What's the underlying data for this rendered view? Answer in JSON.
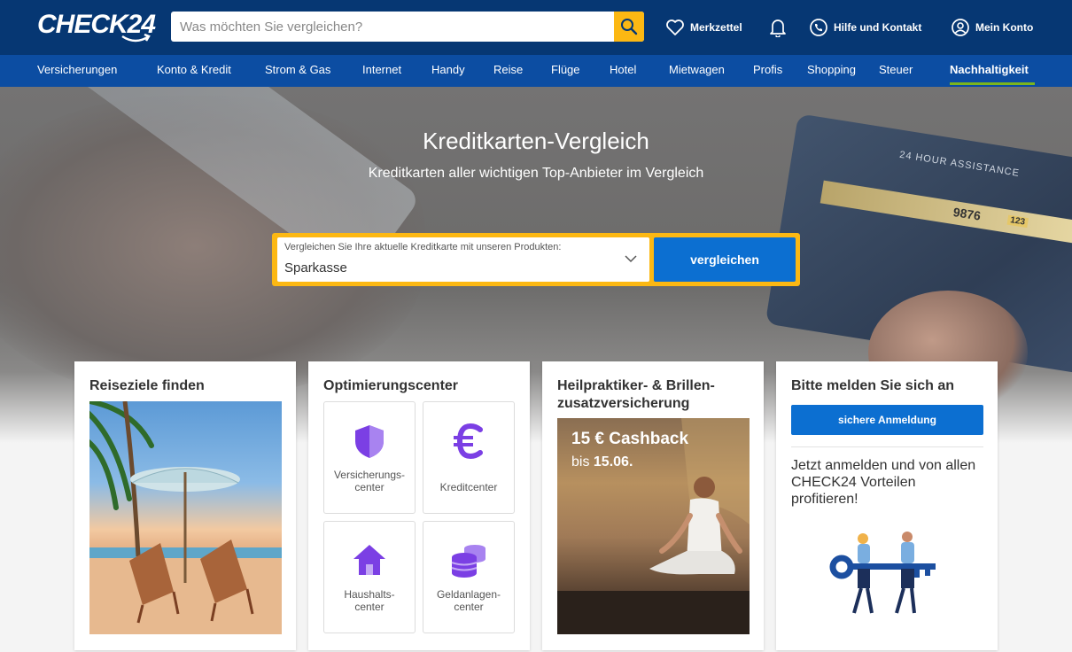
{
  "header": {
    "logo": "CHECK24",
    "search_placeholder": "Was möchten Sie vergleichen?",
    "search_icon": "search-icon",
    "items": [
      {
        "label": "Merkzettel",
        "icon": "heart-icon"
      },
      {
        "label": "",
        "icon": "bell-icon"
      },
      {
        "label": "Hilfe und Kontakt",
        "icon": "phone-chat-icon"
      },
      {
        "label": "Mein Konto",
        "icon": "user-icon"
      }
    ]
  },
  "nav": {
    "items": [
      "Versicherungen",
      "Konto & Kredit",
      "Strom & Gas",
      "Internet",
      "Handy",
      "Reise",
      "Flüge",
      "Hotel",
      "Mietwagen",
      "Profis",
      "Shopping",
      "Steuer",
      "Nachhaltigkeit"
    ],
    "active": "Nachhaltigkeit"
  },
  "hero": {
    "title": "Kreditkarten-Vergleich",
    "subtitle": "Kreditkarten aller wichtigen Top-Anbieter im Vergleich",
    "select_label": "Vergleichen Sie Ihre aktuelle Kreditkarte mit unseren Produkten:",
    "select_value": "Sparkasse",
    "button": "vergleichen",
    "card_text_1": "24 HOUR ASSISTANCE",
    "card_text_2": "9876",
    "card_text_3": "123"
  },
  "cards": {
    "travel": {
      "title": "Reiseziele finden"
    },
    "optimize": {
      "title": "Optimierungscenter",
      "tiles": [
        {
          "label_1": "Versicherungs-",
          "label_2": "center",
          "icon": "shield-icon"
        },
        {
          "label_1": "Kreditcenter",
          "label_2": "",
          "icon": "euro-icon"
        },
        {
          "label_1": "Haushalts-",
          "label_2": "center",
          "icon": "house-icon"
        },
        {
          "label_1": "Geldanlagen-",
          "label_2": "center",
          "icon": "coins-icon"
        }
      ]
    },
    "promo": {
      "title": "Heilpraktiker- & Brillen-zusatzversicherung",
      "line1": "15 € Cashback",
      "line2_prefix": "bis",
      "line2_bold": "15.06."
    },
    "login": {
      "title": "Bitte melden Sie sich an",
      "button": "sichere Anmeldung",
      "text": "Jetzt anmelden und von allen CHECK24 Vorteilen profitieren!"
    }
  },
  "colors": {
    "header_bg": "#063773",
    "nav_bg": "#0c4da2",
    "accent_yellow": "#fcb813",
    "button_blue": "#0c6fd1",
    "active_underline": "#7ab51d",
    "icon_purple": "#7b3fe4"
  }
}
